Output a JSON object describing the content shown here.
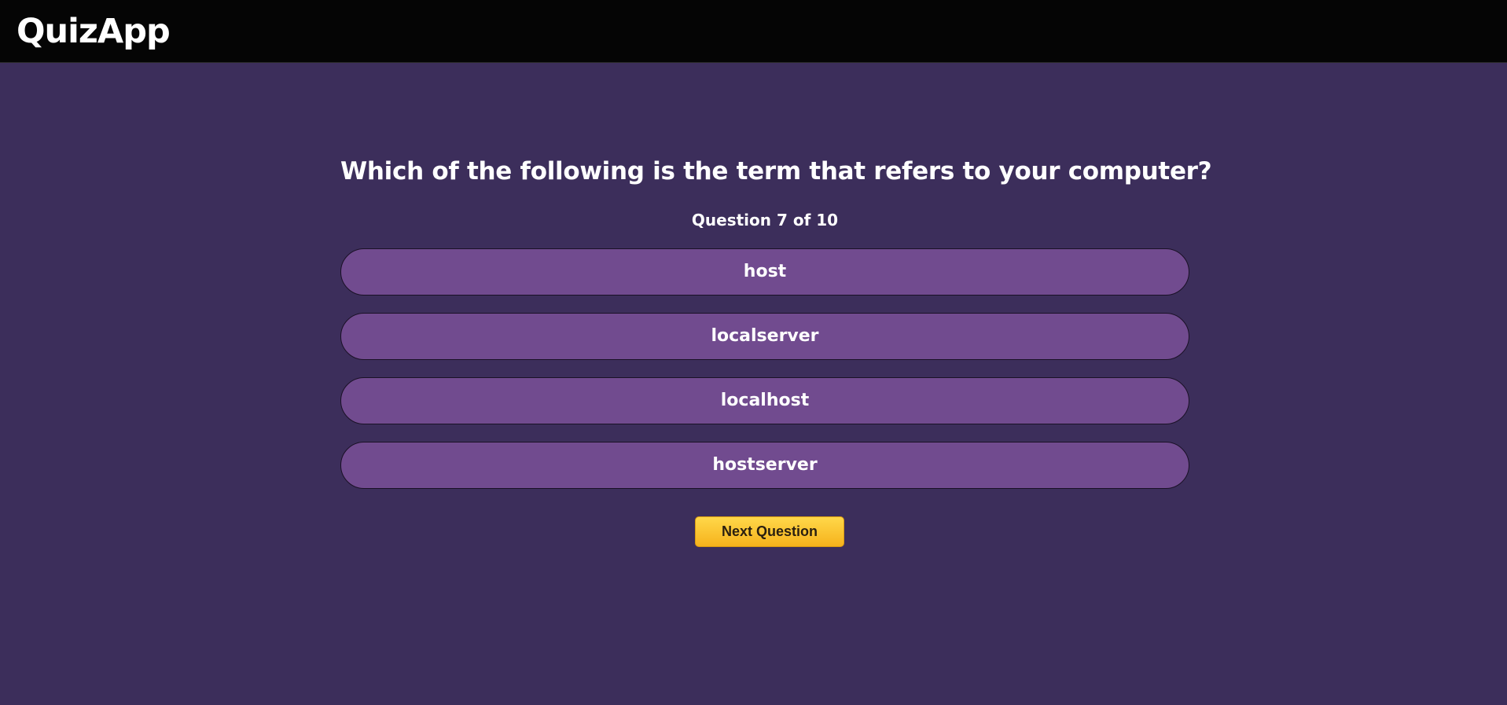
{
  "app": {
    "title": "QuizApp"
  },
  "quiz": {
    "question": "Which of the following is the term that refers to your computer?",
    "progress": "Question 7 of 10",
    "answers": [
      {
        "label": "host"
      },
      {
        "label": "localserver"
      },
      {
        "label": "localhost"
      },
      {
        "label": "hostserver"
      }
    ],
    "next_label": "Next Question"
  },
  "colors": {
    "background": "#3c2e5b",
    "topbar": "#050505",
    "answer_bg": "#714b8f",
    "button_accent": "#f6b21c"
  }
}
